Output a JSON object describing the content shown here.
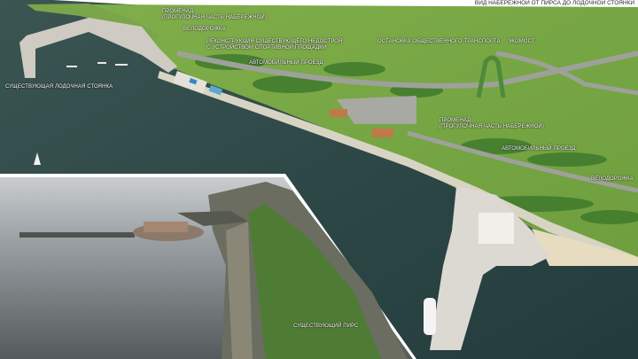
{
  "header": {
    "title": "ВИД НАБЕРЕЖНОЙ ОТ ПИРСА ДО ЛОДОЧНОЙ СТОЯНКИ"
  },
  "labels": {
    "promenade_top": "ПРОМЕНАД\n(ПРОГУЛОЧНАЯ ЧАСТЬ НАБЕРЕЖНОЙ)",
    "bike_path_top": "ВЕЛОДОРОЖКА",
    "reconstruction": "РЕКОНСТРУКЦИЯ СУЩЕСТВУЮЩЕГО НЕДОСТРОЯ\nС УСТРОЙСТВОМ СПОРТИВНОЙ ПЛОЩАДКИ",
    "bus_stop": "ОСТАНОВКА ОБЩЕСТВЕННОГО ТРАНСПОРТА",
    "eco_bridge": "ЭКОМОСТ",
    "car_road_top": "АВТОМОБИЛЬНЫЙ ПРОЕЗД",
    "boat_parking": "СУЩЕСТВУЮЩАЯ ЛОДОЧНАЯ СТОЯНКА",
    "promenade_right": "ПРОМЕНАД\n(ПРОГУЛОЧНАЯ ЧАСТЬ НАБЕРЕЖНОЙ)",
    "car_road_right": "АВТОМОБИЛЬНЫЙ ПРОЕЗД",
    "bike_path_right": "ВЕЛОДОРОЖКА",
    "existing_pier": "СУЩЕСТВУЮЩИЙ ПИРС"
  },
  "colors": {
    "water": "#2f4a4a",
    "land": "#86b34d",
    "sky": "#ffffff",
    "road": "#8b8f8a",
    "label_text": "#ffffff"
  }
}
